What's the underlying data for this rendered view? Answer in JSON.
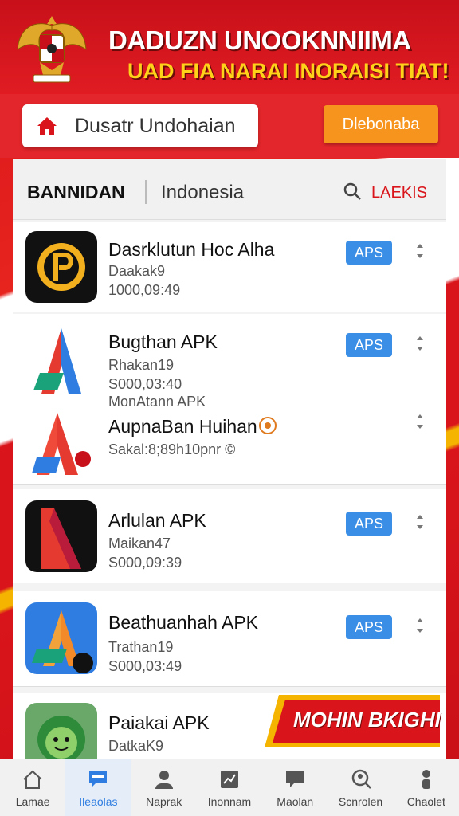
{
  "header": {
    "title": "DADUZN UNOOKNNIIMA",
    "subtitle": "UAD FIA NARAI INORAISI TIAT!"
  },
  "topbar": {
    "search_value": "Dusatr Undohaian",
    "action_button": "Dlebonaba"
  },
  "filter": {
    "category": "BANNIDAN",
    "country": "Indonesia",
    "link": "LAEKIS"
  },
  "apps": [
    {
      "name": "Dasrklutun Hoc Alha",
      "line1": "Daakak9",
      "line2": "1000,09:49",
      "button": "APS"
    },
    {
      "name": "Bugthan APK",
      "line1": "Rhakan19",
      "line2": "S000,03:40",
      "button": "APS"
    },
    {
      "name": "AupnaBan Huihan",
      "pre_name": "MonAtann APK",
      "line1": "Sakal:8;89h10pnr ©",
      "button": ""
    },
    {
      "name": "Arlulan APK",
      "line1": "Maikan47",
      "line2": "S000,09:39",
      "button": "APS"
    },
    {
      "name": "Beathuanhah APK",
      "line1": "Trathan19",
      "line2": "S000,03:49",
      "button": "APS"
    },
    {
      "name": "Paiakai APK",
      "line1": "DatkaK9",
      "line2": "",
      "button": ""
    }
  ],
  "promo": {
    "text": "MOHIN BKIGHI"
  },
  "nav": [
    {
      "label": "Lamae",
      "icon": "home-icon"
    },
    {
      "label": "Ileaolas",
      "icon": "chat-icon"
    },
    {
      "label": "Naprak",
      "icon": "user-icon"
    },
    {
      "label": "Inonnam",
      "icon": "chart-icon"
    },
    {
      "label": "Maolan",
      "icon": "message-icon"
    },
    {
      "label": "Scnrolen",
      "icon": "search-user-icon"
    },
    {
      "label": "Chaolet",
      "icon": "person-icon"
    }
  ],
  "colors": {
    "brand_red": "#d9151b",
    "accent_yellow": "#ffd21a",
    "button_blue": "#3a8ee6",
    "orange": "#f7941d"
  }
}
